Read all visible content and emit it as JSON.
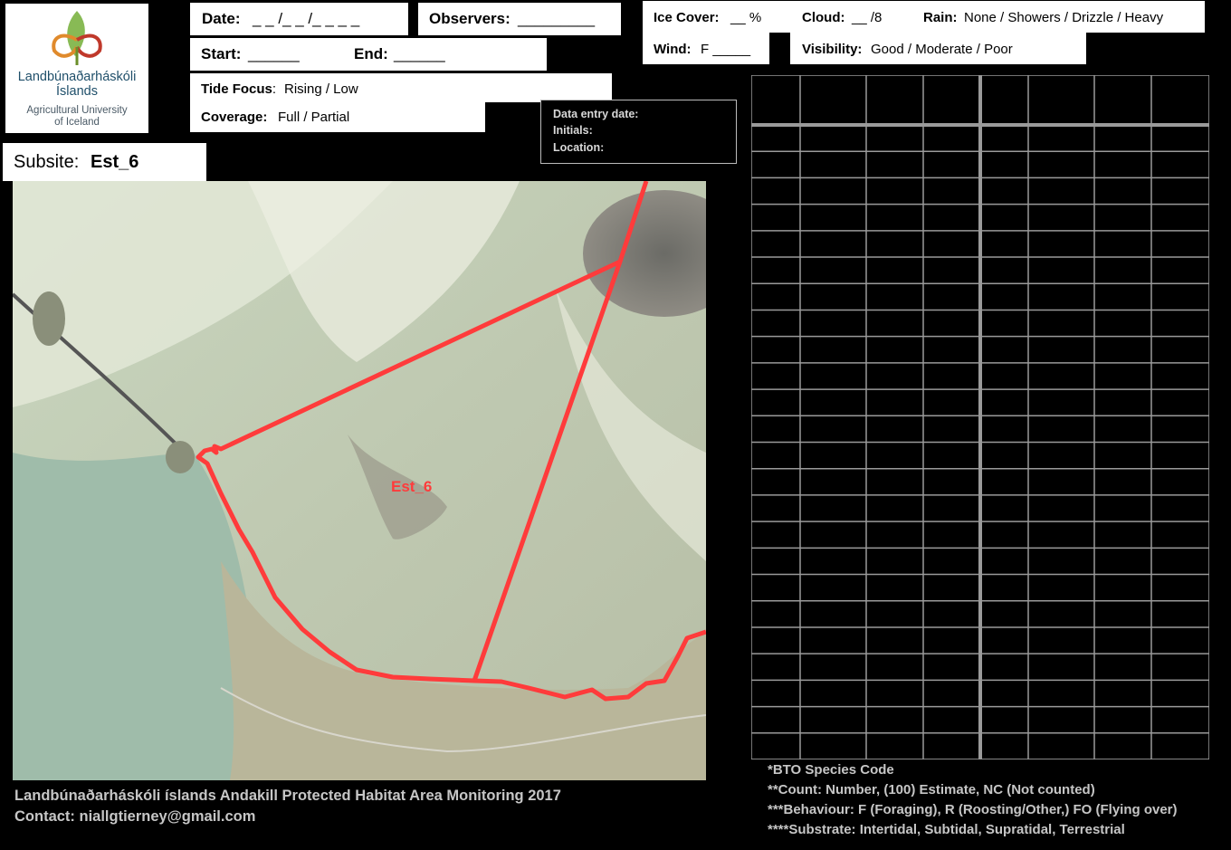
{
  "logo": {
    "name_line1": "Landbúnaðarháskóli",
    "name_line2": "Íslands",
    "en_line1": "Agricultural University",
    "en_line2": "of Iceland"
  },
  "form": {
    "date_label": "Date:",
    "date_value": "_ _  /_ _  /_ _ _ _",
    "observers_label": "Observers:",
    "observers_value": "_________",
    "start_label": "Start:",
    "start_value": "______",
    "end_label": "End:",
    "end_value": "______",
    "tide_label": "Tide Focus",
    "tide_value": "Rising  /  Low",
    "coverage_label": "Coverage:",
    "coverage_value": "Full / Partial",
    "ice_label": "Ice Cover:",
    "ice_value": "__  %",
    "cloud_label": "Cloud:",
    "cloud_value": "__ /8",
    "rain_label": "Rain:",
    "rain_value": "None / Showers / Drizzle / Heavy",
    "wind_label": "Wind:",
    "wind_value": "F _____",
    "visibility_label": "Visibility:",
    "visibility_value": "Good / Moderate / Poor"
  },
  "data_entry": {
    "date_label": "Data entry date:",
    "initials_label": "Initials:",
    "location_label": "Location:"
  },
  "subsite": {
    "label": "Subsite:",
    "value": "Est_6"
  },
  "map": {
    "area_label": "Est_6",
    "boundary_color": "#ff3b3b"
  },
  "grid": {
    "rows": 24,
    "columns": 8
  },
  "footer": {
    "line1": "Landbúnaðarháskóli íslands Andakill Protected Habitat Area Monitoring 2017",
    "line2": "Contact: niallgtierney@gmail.com"
  },
  "notes": [
    "*BTO Species Code",
    "**Count: Number, (100) Estimate, NC (Not counted)",
    "***Behaviour: F (Foraging), R (Roosting/Other,) FO (Flying over)",
    "****Substrate: Intertidal, Subtidal, Supratidal, Terrestrial"
  ]
}
